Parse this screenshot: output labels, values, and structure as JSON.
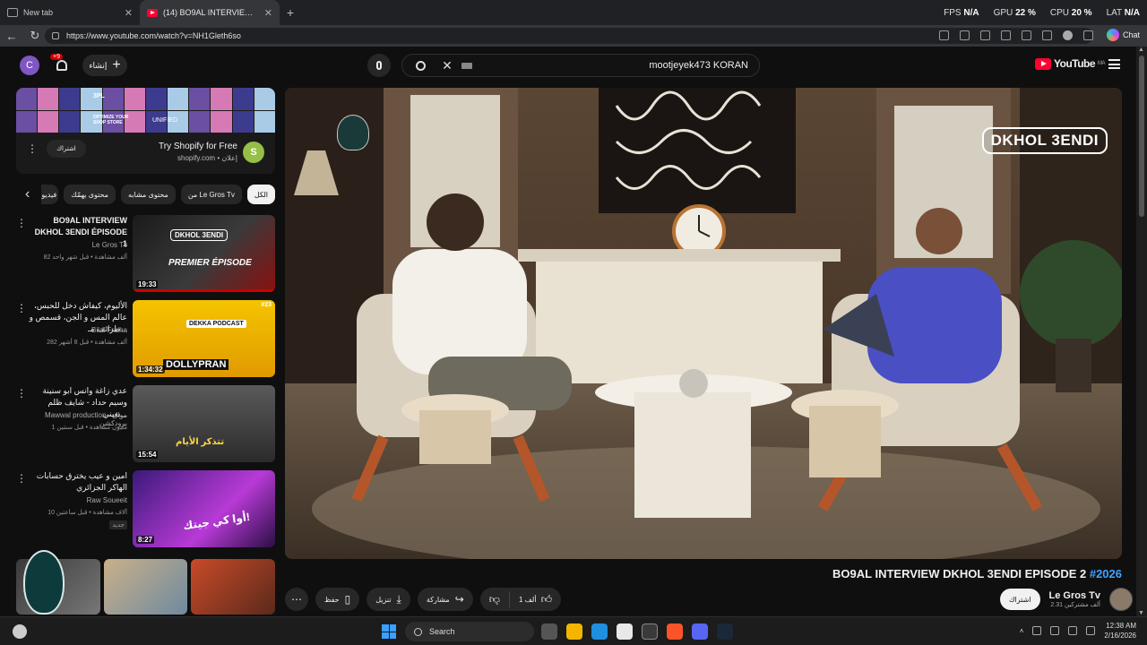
{
  "browser": {
    "tabs": [
      {
        "title": "New tab",
        "active": false
      },
      {
        "title": "(14) BO9AL INTERVIEW DKHOL 3ENDI",
        "active": true
      }
    ],
    "new_tab": "+",
    "url": "https://www.youtube.com/watch?v=NH1Gleth6so",
    "chat_label": "Chat",
    "perf": {
      "fps_label": "FPS",
      "fps": "N/A",
      "gpu_label": "GPU",
      "gpu": "22 %",
      "cpu_label": "CPU",
      "cpu": "20 %",
      "lat_label": "LAT",
      "lat": "N/A"
    }
  },
  "youtube": {
    "avatar_letter": "C",
    "notification_badge": "+9",
    "create_label": "إنشاء",
    "search_query": "mootjeyek473 KORAN",
    "logo_text": "YouTube",
    "logo_region": "MA"
  },
  "ad": {
    "banner_words": [
      "3PL",
      "OPTIMIZE YOUR SHOP STORE",
      "UNIFIED"
    ],
    "subscribe_label": "اشتراك",
    "title": "Try Shopify for Free",
    "domain": "shopify.com • إعلان",
    "logo_letter": "S"
  },
  "chips": [
    {
      "label": "الكل",
      "active": true
    },
    {
      "label": "من Le Gros Tv",
      "active": false
    },
    {
      "label": "محتوى مشابه",
      "active": false
    },
    {
      "label": "محتوى يهمّك",
      "active": false
    },
    {
      "label": "فيديو",
      "active": false
    }
  ],
  "recommendations": [
    {
      "title": "BO9AL INTERVIEW DKHOL 3ENDI ÉPISODE 1",
      "channel": "Le Gros Tv",
      "meta": "82 ألف مشاهدة • قبل شهر واحد",
      "duration": "19:33",
      "thumb_text": "PREMIER ÉPISODE",
      "thumb_logo": "DKHOL 3ENDI",
      "bold": true
    },
    {
      "title": "الأليوم، كيفاش دخل للحبس، عالم المس و الجن، قسمص و طرائف مـ...",
      "channel": "Bilal Fraiha",
      "meta": "282 ألف مشاهدة • قبل 8 أشهر",
      "duration": "1:34:32",
      "thumb_text": "DOLLYPRAN",
      "thumb_logo": "DEKKA PODCAST",
      "thumb_num": "#23",
      "bold": false
    },
    {
      "title": "عدي زاغة وانس ابو سنينة وسيم حداد - شايف ظلم بعيني...",
      "channel": "Mawwal production - موال برودكشن",
      "meta": "1 مليون مشاهدة • قبل سنتين",
      "duration": "15:54",
      "thumb_text": "تتذكر الأيام",
      "bold": false
    },
    {
      "title": "امين و عيب يخترق حسابات الهاكر الجزائري",
      "channel": "Raw Soueeit",
      "meta": "10 آلاف مشاهدة • قبل ساعتين",
      "tag": "جديد",
      "duration": "8:27",
      "thumb_text": "أوا كي جيتك!",
      "bold": false
    }
  ],
  "video": {
    "title": "BO9AL INTERVIEW DKHOL 3ENDI EPISODE 2",
    "hashtag": "#2026",
    "overlay_logo": "DKHOL 3ENDI",
    "channel": "Le Gros Tv",
    "subscribers": "2.31 ألف مشتركين",
    "subscribe_label": "اشتراك",
    "likes": "1 ألف",
    "share_label": "مشاركة",
    "download_label": "تنزيل",
    "save_label": "حفظ",
    "more": "⋯"
  },
  "taskbar": {
    "search_label": "Search",
    "time": "12:38 AM",
    "date": "2/16/2026"
  }
}
